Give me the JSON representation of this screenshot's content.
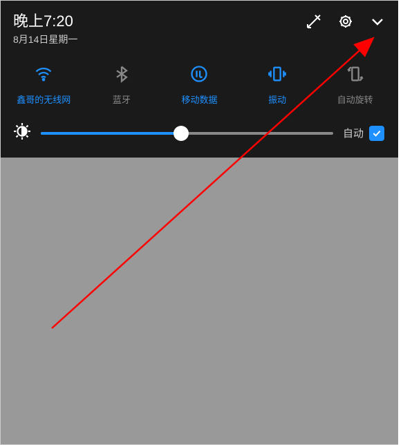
{
  "status": {
    "time": "晚上7:20",
    "date": "8月14日星期一"
  },
  "toggles": {
    "wifi": "鑫哥的无线网",
    "bluetooth": "蓝牙",
    "mobile_data": "移动数据",
    "vibrate": "振动",
    "auto_rotate": "自动旋转"
  },
  "brightness": {
    "auto_label": "自动",
    "auto_checked": true,
    "value_percent": 48
  },
  "colors": {
    "accent": "#1e90ff",
    "inactive": "#888888"
  }
}
